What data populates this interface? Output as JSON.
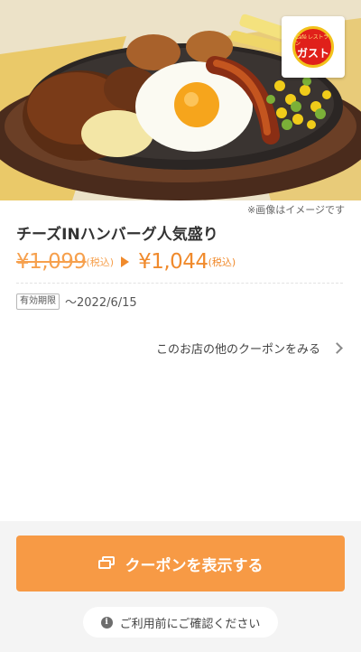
{
  "hero": {
    "image_name": "cheese-in-hamburg-plate-photo",
    "logo": {
      "sub": "Café レストラン",
      "main": "ガスト",
      "color": "#e0201a"
    },
    "note": "※画像はイメージです"
  },
  "coupon": {
    "title": "チーズINハンバーグ人気盛り",
    "old_price": "¥1,099",
    "old_tax": "(税込)",
    "new_price": "¥1,044",
    "new_tax": "(税込)",
    "accent_color": "#f79a45"
  },
  "validity": {
    "badge": "有効期限",
    "date": "〜2022/6/15"
  },
  "links": {
    "other_coupons": "このお店の他のクーポンをみる"
  },
  "actions": {
    "show_coupon": "クーポンを表示する",
    "confirm": "ご利用前にご確認ください"
  }
}
